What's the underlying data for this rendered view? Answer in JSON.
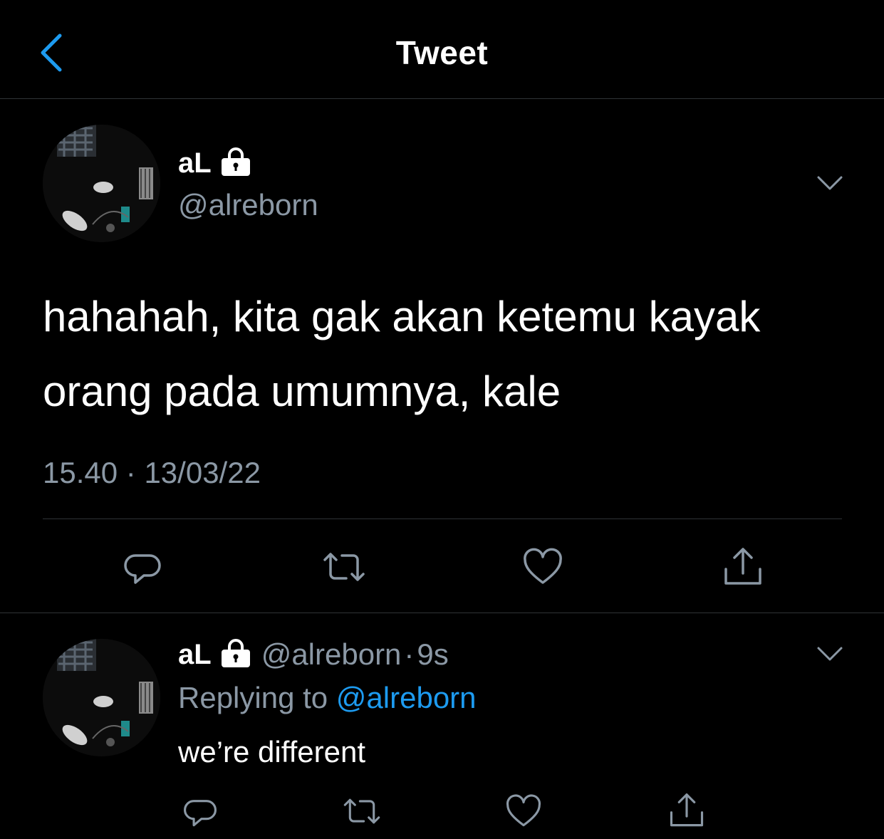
{
  "header": {
    "title": "Tweet"
  },
  "main_tweet": {
    "name": "aL",
    "handle": "@alreborn",
    "text_line1": "hahahah, kita gak akan ketemu kayak",
    "text_line2": "orang pada umumnya, kale",
    "time": "15.40",
    "separator": "·",
    "date": "13/03/22"
  },
  "reply": {
    "name": "aL",
    "handle": "@alreborn",
    "separator": "·",
    "age": "9s",
    "replying_prefix": "Replying to",
    "replying_to": "@alreborn",
    "text": "we’re different"
  },
  "colors": {
    "background": "#000000",
    "secondary_text": "#8b98a5",
    "accent": "#1d9bf0",
    "divider": "#2f3336"
  },
  "icons": [
    "chevron-left-icon",
    "lock-icon",
    "chevron-down-icon",
    "reply-icon",
    "retweet-icon",
    "like-icon",
    "share-icon"
  ]
}
